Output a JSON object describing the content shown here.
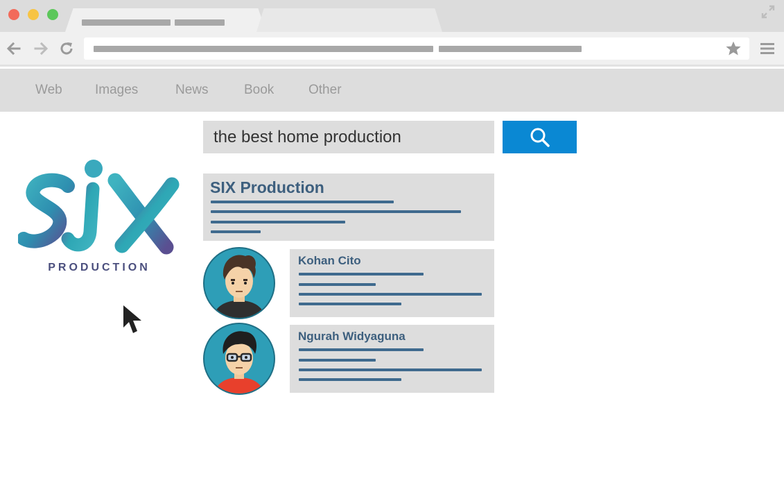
{
  "window": {
    "controls": [
      "close",
      "minimize",
      "maximize"
    ],
    "resize_icon": "expand-arrows-icon"
  },
  "toolbar": {
    "back_icon": "back-arrow-icon",
    "forward_icon": "forward-arrow-icon",
    "reload_icon": "reload-icon",
    "bookmark_icon": "star-icon",
    "menu_icon": "hamburger-menu-icon"
  },
  "categories": [
    "Web",
    "Images",
    "News",
    "Book",
    "Other"
  ],
  "search": {
    "value": "the best home production",
    "button_icon": "search-icon",
    "button_color": "#0a88d3"
  },
  "logo": {
    "subtitle": "PRODUCTION",
    "colors": {
      "teal": "#2ea7b5",
      "purple": "#5a4f91"
    }
  },
  "results": {
    "main": {
      "title": "SIX Production"
    },
    "people": [
      {
        "name": "Kohan Cito",
        "avatar_icon": "man-avatar-icon"
      },
      {
        "name": "Ngurah Widyaguna",
        "avatar_icon": "man-with-glasses-avatar-icon"
      }
    ]
  },
  "colors": {
    "chrome_bg": "#dcdcdc",
    "result_card": "#dddddd",
    "result_title": "#3d5f7e",
    "avatar_bg": "#2e9eb7"
  }
}
